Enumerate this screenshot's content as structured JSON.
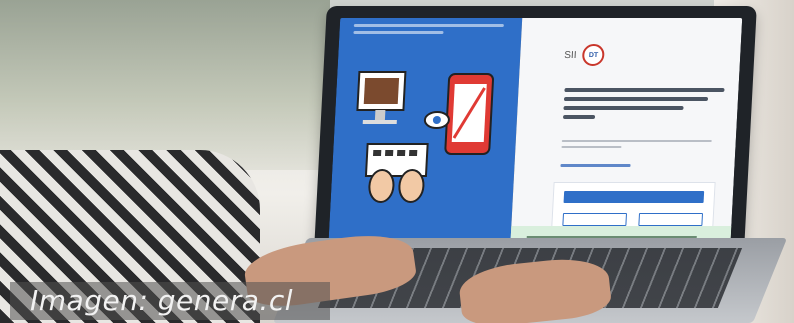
{
  "photo": {
    "caption": "Imagen: genera.cl"
  },
  "website": {
    "logo_text": "SII",
    "seal_text": "DT"
  },
  "colors": {
    "site_blue": "#2f6fc8",
    "site_green": "#d9efdd",
    "phone_red": "#e03a34"
  }
}
